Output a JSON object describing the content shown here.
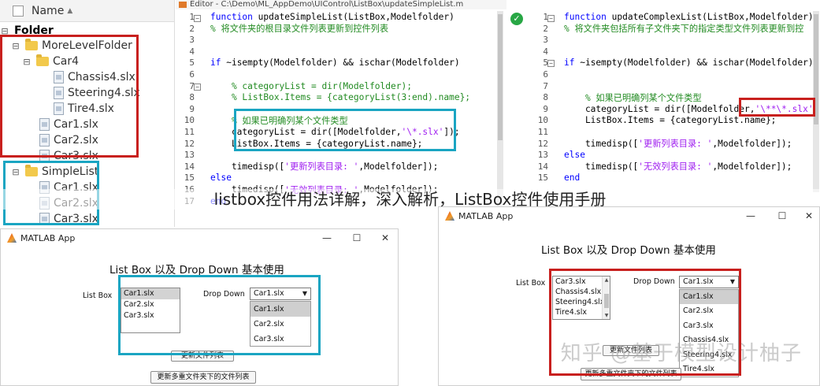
{
  "tree": {
    "header": "Name",
    "root": "Folder",
    "items": [
      {
        "label": "MoreLevelFolder",
        "type": "folder"
      },
      {
        "label": "Car4",
        "type": "folder"
      },
      {
        "label": "Chassis4.slx",
        "type": "file"
      },
      {
        "label": "Steering4.slx",
        "type": "file"
      },
      {
        "label": "Tire4.slx",
        "type": "file"
      },
      {
        "label": "Car1.slx",
        "type": "file"
      },
      {
        "label": "Car2.slx",
        "type": "file"
      },
      {
        "label": "Car3.slx",
        "type": "file"
      },
      {
        "label": "SimpleList",
        "type": "folder"
      },
      {
        "label": "Car1.slx",
        "type": "file"
      },
      {
        "label": "Car2.slx",
        "type": "file"
      },
      {
        "label": "Car3.slx",
        "type": "file"
      }
    ]
  },
  "editor_left": {
    "title": "Editor - C:\\Demo\\ML_AppDemo\\UIControl\\ListBox\\updateSimpleList.m",
    "lines": [
      {
        "n": "1",
        "parts": [
          [
            "kw",
            "function "
          ],
          [
            "tx",
            "updateSimpleList(ListBox,Modelfolder)"
          ]
        ]
      },
      {
        "n": "2",
        "parts": [
          [
            "cm",
            "% 将文件夹的根目录文件列表更新到控件列表"
          ]
        ]
      },
      {
        "n": "3",
        "parts": []
      },
      {
        "n": "4",
        "parts": []
      },
      {
        "n": "5",
        "parts": [
          [
            "kw",
            "if "
          ],
          [
            "tx",
            "~isempty(Modelfolder) && ischar(Modelfolder)"
          ]
        ]
      },
      {
        "n": "6",
        "parts": []
      },
      {
        "n": "7",
        "parts": [
          [
            "cm",
            "    % categoryList = dir(Modelfolder);"
          ]
        ]
      },
      {
        "n": "8",
        "parts": [
          [
            "cm",
            "    % ListBox.Items = {categoryList(3:end).name};"
          ]
        ]
      },
      {
        "n": "9",
        "parts": []
      },
      {
        "n": "10",
        "parts": [
          [
            "cm",
            "    % 如果已明确列某个文件类型"
          ]
        ]
      },
      {
        "n": "11",
        "parts": [
          [
            "tx",
            "    categoryList = dir([Modelfolder,"
          ],
          [
            "st",
            "'\\*.slx'"
          ],
          [
            "tx",
            "]);"
          ]
        ]
      },
      {
        "n": "12",
        "parts": [
          [
            "tx",
            "    ListBox.Items = {categoryList.name};"
          ]
        ]
      },
      {
        "n": "13",
        "parts": []
      },
      {
        "n": "14",
        "parts": [
          [
            "tx",
            "    timedisp(["
          ],
          [
            "st",
            "'更新列表目录: '"
          ],
          [
            "tx",
            ",Modelfolder]);"
          ]
        ]
      },
      {
        "n": "15",
        "parts": [
          [
            "kw",
            "else"
          ]
        ]
      },
      {
        "n": "16",
        "parts": [
          [
            "tx",
            "    timedisp(["
          ],
          [
            "st",
            "'无效列表目录: '"
          ],
          [
            "tx",
            ",Modelfolder]);"
          ]
        ]
      },
      {
        "n": "17",
        "parts": [
          [
            "kw",
            "end"
          ]
        ]
      }
    ]
  },
  "editor_right": {
    "lines": [
      {
        "n": "1",
        "parts": [
          [
            "kw",
            "function "
          ],
          [
            "tx",
            "updateComplexList(ListBox,Modelfolder)"
          ]
        ]
      },
      {
        "n": "2",
        "parts": [
          [
            "cm",
            "% 将文件夹包括所有子文件夹下的指定类型文件列表更新到控"
          ]
        ]
      },
      {
        "n": "3",
        "parts": []
      },
      {
        "n": "4",
        "parts": []
      },
      {
        "n": "5",
        "parts": [
          [
            "kw",
            "if "
          ],
          [
            "tx",
            "~isempty(Modelfolder) && ischar(Modelfolder)"
          ]
        ]
      },
      {
        "n": "6",
        "parts": []
      },
      {
        "n": "7",
        "parts": []
      },
      {
        "n": "8",
        "parts": [
          [
            "cm",
            "    % 如果已明确列某个文件类型"
          ]
        ]
      },
      {
        "n": "9",
        "parts": [
          [
            "tx",
            "    categoryList = dir([Modelfolder,"
          ],
          [
            "st",
            "'\\**\\*.slx'"
          ],
          [
            "tx",
            "]);"
          ]
        ]
      },
      {
        "n": "10",
        "parts": [
          [
            "tx",
            "    ListBox.Items = {categoryList.name};"
          ]
        ]
      },
      {
        "n": "11",
        "parts": []
      },
      {
        "n": "12",
        "parts": [
          [
            "tx",
            "    timedisp(["
          ],
          [
            "st",
            "'更新列表目录: '"
          ],
          [
            "tx",
            ",Modelfolder]);"
          ]
        ]
      },
      {
        "n": "13",
        "parts": [
          [
            "kw",
            "else"
          ]
        ]
      },
      {
        "n": "14",
        "parts": [
          [
            "tx",
            "    timedisp(["
          ],
          [
            "st",
            "'无效列表目录: '"
          ],
          [
            "tx",
            ",Modelfolder]);"
          ]
        ]
      },
      {
        "n": "15",
        "parts": [
          [
            "kw",
            "end"
          ]
        ]
      }
    ]
  },
  "caption": "listbox控件用法详解，深入解析，ListBox控件使用手册",
  "app_left": {
    "window_title": "MATLAB App",
    "heading": "List Box 以及 Drop Down 基本使用",
    "listbox_label": "List Box",
    "listbox_items": [
      "Car1.slx",
      "Car2.slx",
      "Car3.slx"
    ],
    "dropdown_label": "Drop Down",
    "dropdown_value": "Car1.slx",
    "dropdown_options": [
      "Car1.slx",
      "Car2.slx",
      "Car3.slx"
    ],
    "button_update": "更新文件列表",
    "button_update_multi": "更新多重文件夹下的文件列表"
  },
  "app_right": {
    "window_title": "MATLAB App",
    "heading": "List Box 以及 Drop Down 基本使用",
    "listbox_label": "List Box",
    "listbox_items": [
      "Car3.slx",
      "Chassis4.slx",
      "Steering4.slx",
      "Tire4.slx"
    ],
    "dropdown_label": "Drop Down",
    "dropdown_value": "Car1.slx",
    "dropdown_options": [
      "Car1.slx",
      "Car2.slx",
      "Car3.slx",
      "Chassis4.slx",
      "Steering4.slx",
      "Tire4.slx"
    ],
    "button_update": "更新文件列表",
    "button_update_multi": "更新多重文件夹下的文件列表"
  },
  "watermark": "知乎 @基于模型设计柚子",
  "window_controls": {
    "minimize": "—",
    "maximize": "☐",
    "close": "✕"
  },
  "colors": {
    "highlight_red": "#c8201e",
    "highlight_teal": "#1aa5c2",
    "keyword": "#0000ff",
    "comment": "#228b22",
    "string": "#a020f0"
  }
}
